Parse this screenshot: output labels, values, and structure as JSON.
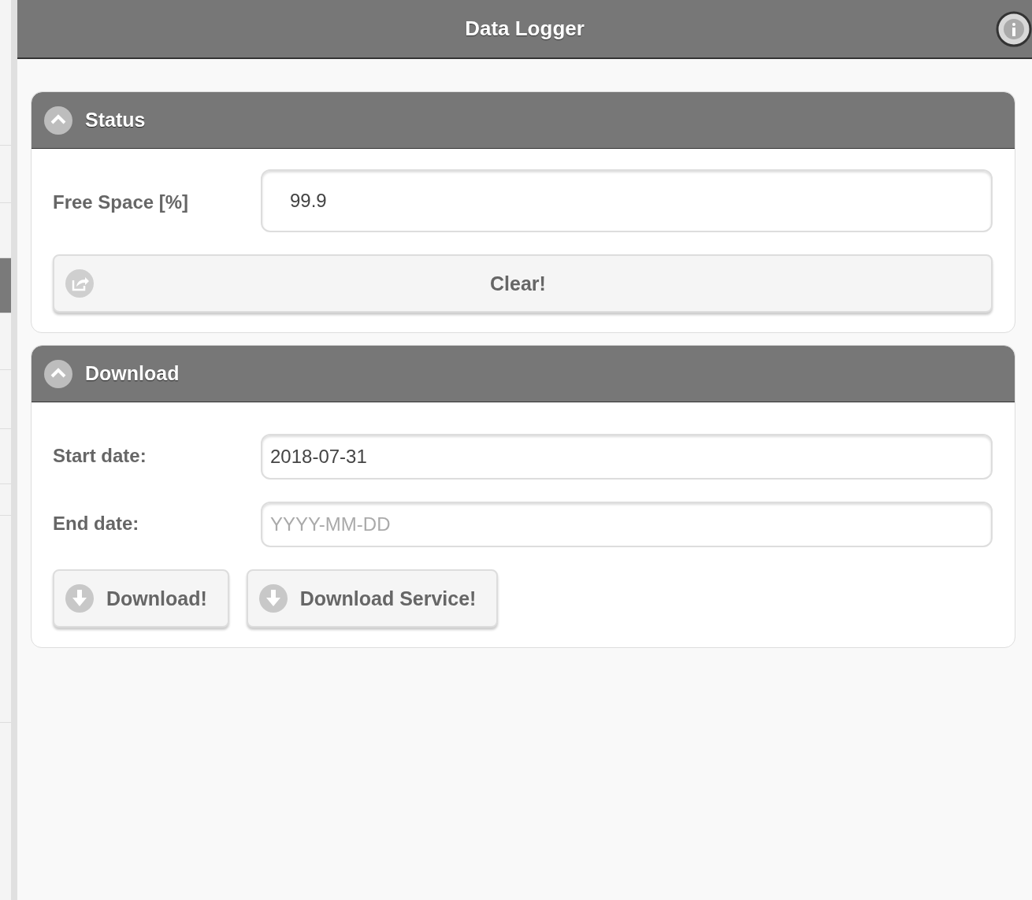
{
  "sidebar": {
    "items": [
      {
        "selected": false
      },
      {
        "selected": false
      },
      {
        "selected": false
      },
      {
        "selected": true
      },
      {
        "selected": false
      },
      {
        "selected": false
      },
      {
        "selected": false
      },
      {
        "selected": false
      },
      {
        "selected": false
      }
    ]
  },
  "header": {
    "title": "Data Logger"
  },
  "sections": [
    {
      "title": "Status",
      "expanded": true,
      "fields": [
        {
          "label": "Free Space [%]",
          "value": "99.9",
          "kind": "readonly"
        }
      ],
      "buttons": [
        {
          "label": "Clear!",
          "kind": "share"
        }
      ]
    },
    {
      "title": "Download",
      "expanded": true,
      "fields": [
        {
          "label": "Start date:",
          "value": "2018-07-31",
          "kind": "input"
        },
        {
          "label": "End date:",
          "placeholder": "YYYY-MM-DD",
          "kind": "input"
        }
      ],
      "buttons": [
        {
          "label": "Download!",
          "kind": "download"
        },
        {
          "label": "Download Service!",
          "kind": "download"
        }
      ]
    }
  ]
}
